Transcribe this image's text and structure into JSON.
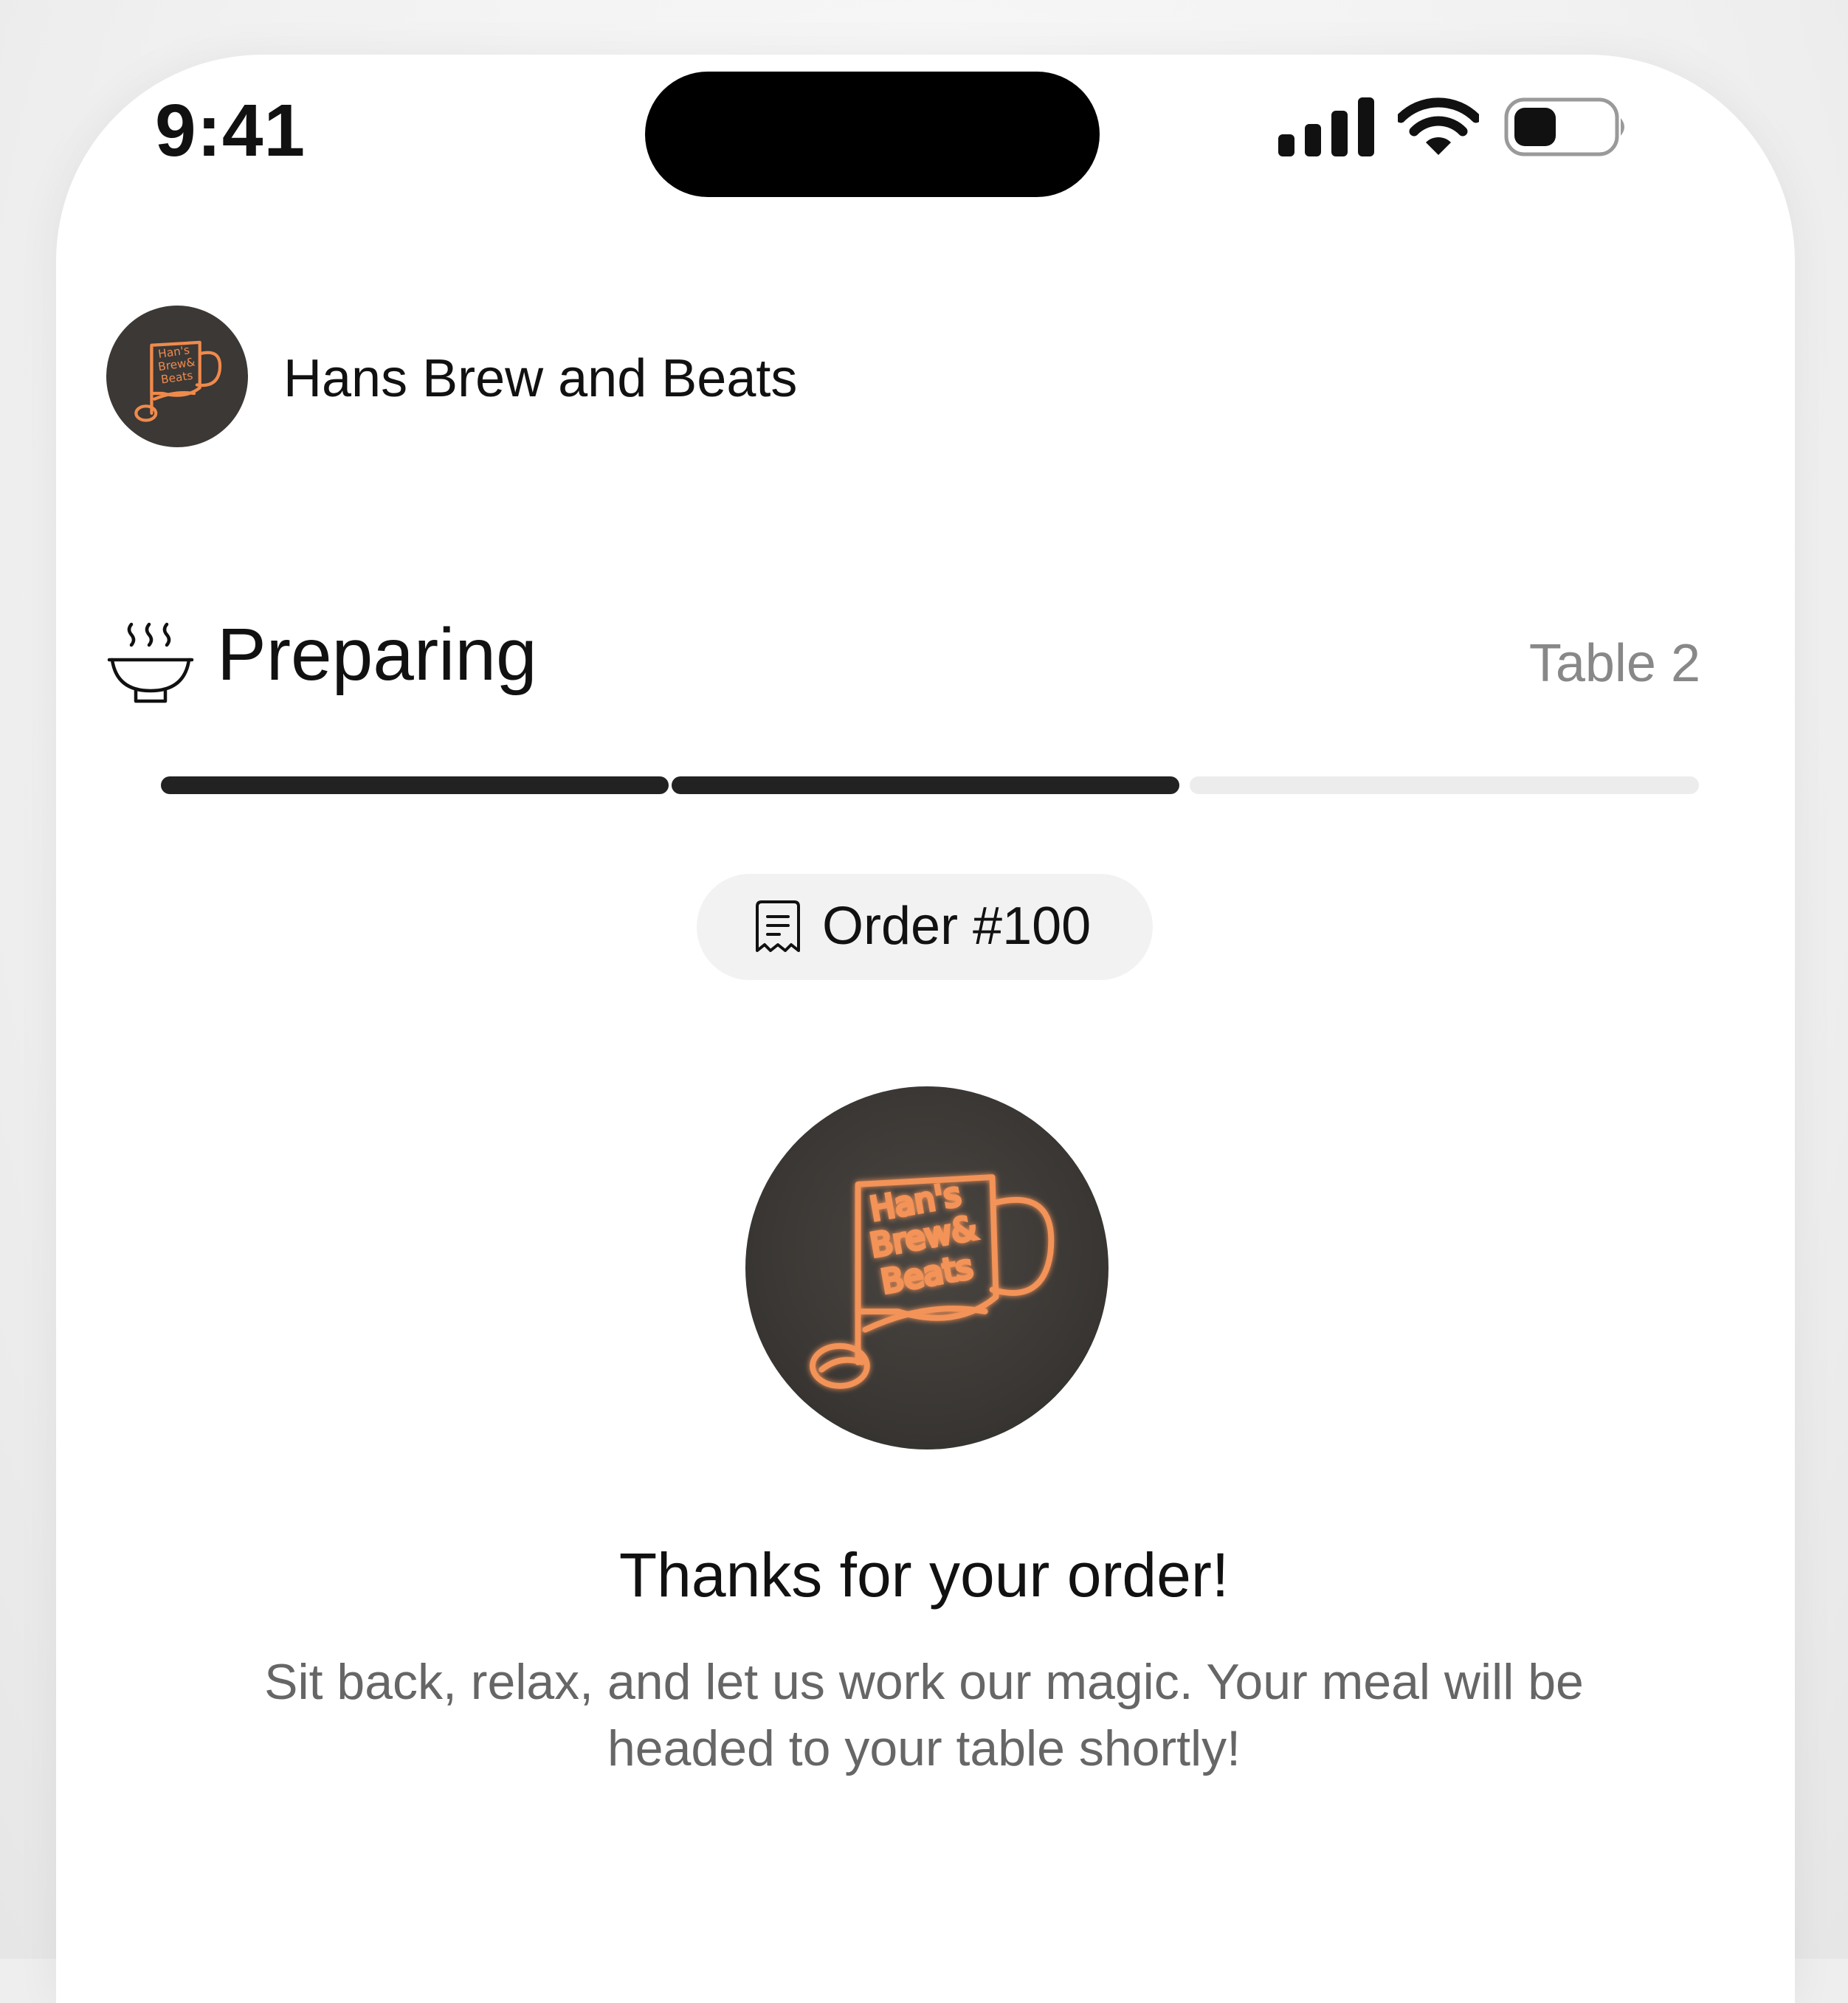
{
  "status_bar": {
    "time": "9:41",
    "icons": [
      "cellular-signal-icon",
      "wifi-icon",
      "battery-icon"
    ]
  },
  "restaurant": {
    "name": "Hans Brew and Beats",
    "logo_lettering": "Han's Brew & Beats"
  },
  "order_status": {
    "icon": "steaming-bowl-icon",
    "label": "Preparing",
    "table": "Table 2",
    "progress_steps_total": 3,
    "progress_steps_completed": 2
  },
  "order": {
    "icon": "receipt-icon",
    "label": "Order #100"
  },
  "confirmation": {
    "title": "Thanks for your order!",
    "message": "Sit back, relax, and let us work our magic. Your meal will be headed to your table shortly!"
  },
  "colors": {
    "progress_done": "#222222",
    "progress_pending": "#ececec",
    "logo_neon": "#f08a4b",
    "logo_background": "#3b3836",
    "muted_text": "#888888"
  }
}
